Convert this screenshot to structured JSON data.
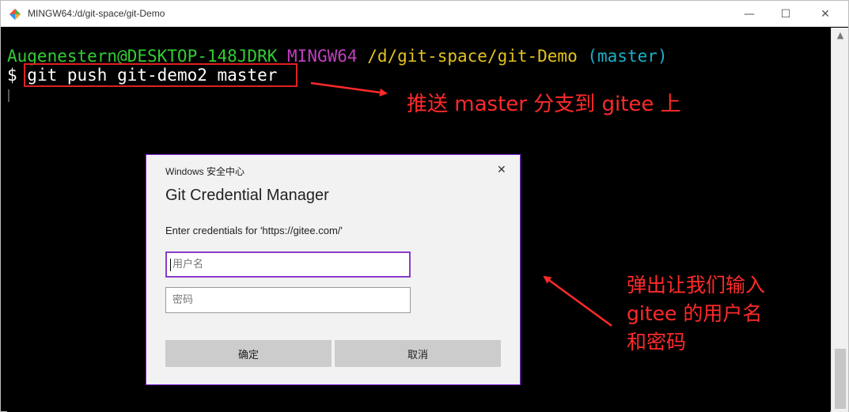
{
  "window": {
    "title": "MINGW64:/d/git-space/git-Demo",
    "minimize_glyph": "—",
    "maximize_glyph": "☐",
    "close_glyph": "✕",
    "icon": "git-bash-icon"
  },
  "terminal": {
    "prompt": {
      "user": "Augenestern@DESKTOP-148JDRK",
      "system": "MINGW64",
      "path": "/d/git-space/git-Demo",
      "branch": "(master)"
    },
    "command_prefix": "$ ",
    "command": "git push git-demo2 master"
  },
  "annotations": {
    "push_note": "推送 master 分支到 gitee 上",
    "dialog_note": "弹出让我们输入\ngitee 的用户名\n和密码"
  },
  "dialog": {
    "source": "Windows 安全中心",
    "close_glyph": "✕",
    "title": "Git Credential Manager",
    "prompt": "Enter credentials for 'https://gitee.com/'",
    "username_placeholder": "用户名",
    "password_placeholder": "密码",
    "ok_label": "确定",
    "cancel_label": "取消"
  },
  "colors": {
    "annotation": "#ff2a2a",
    "dialog_border": "#8a2be2"
  }
}
